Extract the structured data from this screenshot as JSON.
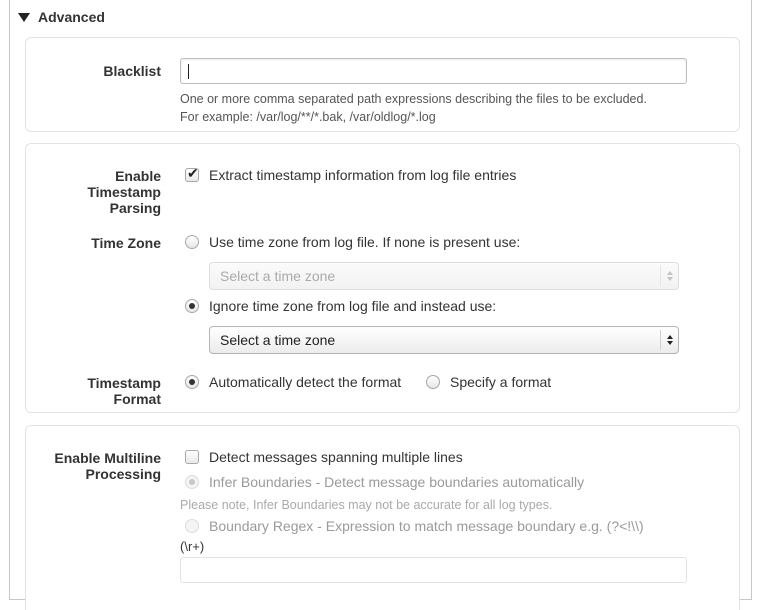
{
  "section": {
    "title": "Advanced"
  },
  "blacklist": {
    "label": "Blacklist",
    "value": "",
    "help_line1": "One or more comma separated path expressions describing the files to be excluded.",
    "help_line2": "For example: /var/log/**/*.bak, /var/oldlog/*.log"
  },
  "timestamp": {
    "label_line1": "Enable",
    "label_line2": "Timestamp",
    "label_line3": "Parsing",
    "checkbox_label": "Extract timestamp information from log file entries",
    "checked": true
  },
  "timezone": {
    "label": "Time Zone",
    "option_log_file": "Use time zone from log file. If none is present use:",
    "select_log_file": "Select a time zone",
    "option_ignore": "Ignore time zone from log file and instead use:",
    "select_ignore": "Select a time zone",
    "selected_option": "ignore"
  },
  "timestamp_format": {
    "label_line1": "Timestamp",
    "label_line2": "Format",
    "option_auto": "Automatically detect the format",
    "option_specify": "Specify a format",
    "selected_option": "auto"
  },
  "multiline": {
    "label_line1": "Enable Multiline",
    "label_line2": "Processing",
    "checkbox_label": "Detect messages spanning multiple lines",
    "checked": false,
    "option_infer": "Infer Boundaries - Detect message boundaries automatically",
    "infer_note": "Please note, Infer Boundaries may not be accurate for all log types.",
    "option_regex_line1": "Boundary Regex - Expression to match message boundary e.g. (?<!\\\\)",
    "option_regex_line2": "(\\r+)",
    "regex_value": ""
  }
}
